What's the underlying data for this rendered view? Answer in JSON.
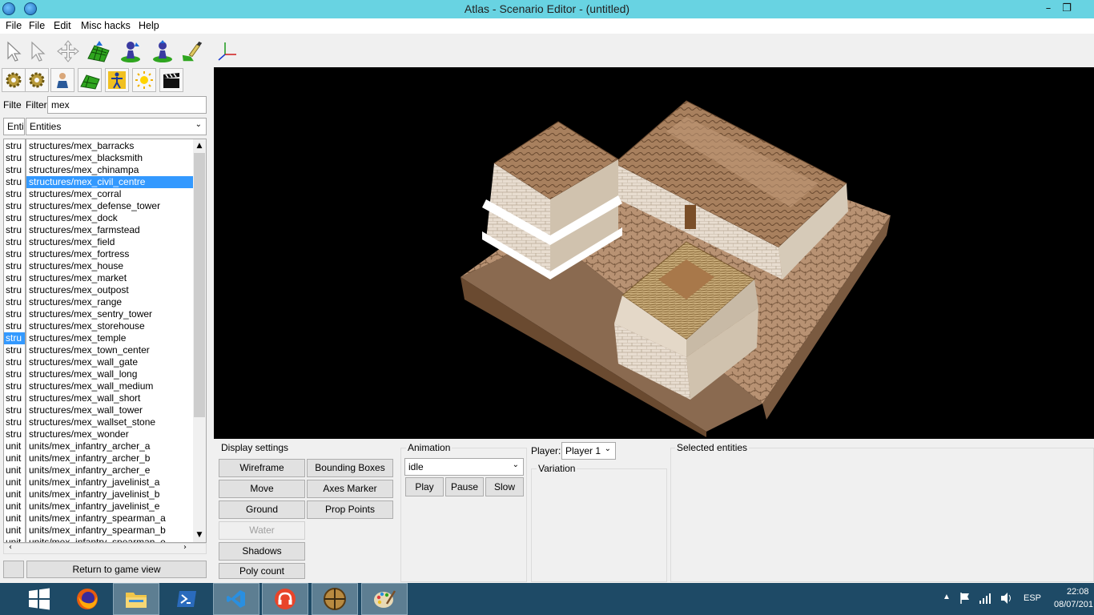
{
  "window": {
    "title": "Atlas - Scenario Editor - (untitled)",
    "minimize_glyph": "–",
    "restore_glyph": "❐",
    "app_icons": [
      "globe-icon",
      "globe-icon"
    ]
  },
  "menu": {
    "items": [
      "File",
      "File",
      "Edit",
      "Misc hacks",
      "Help"
    ]
  },
  "toolbar": {
    "tools": [
      "select-arrow-icon",
      "select-arrow-alt-icon",
      "move-cross-icon",
      "terrain-elevation-icon",
      "player-pawn-icon",
      "player-pawn-alt-icon",
      "paint-brush-icon",
      "axes-icon"
    ],
    "sidebar_tabs": [
      "gear-icon",
      "gear-alt-icon",
      "person-icon",
      "terrain-icon",
      "figure-icon",
      "sun-icon",
      "clapper-icon"
    ]
  },
  "left_panel": {
    "filter_label_short": "Filte",
    "filter_label": "Filter",
    "filter_value": "mex",
    "type_label_short": "Enti",
    "type_select": "Entities",
    "short_column": [
      "stru",
      "stru",
      "stru",
      "stru",
      "stru",
      "stru",
      "stru",
      "stru",
      "stru",
      "stru",
      "stru",
      "stru",
      "stru",
      "stru",
      "stru",
      "stru",
      "stru",
      "stru",
      "stru",
      "stru",
      "stru",
      "stru",
      "stru",
      "stru",
      "stru",
      "unit",
      "unit",
      "unit",
      "unit",
      "unit",
      "unit",
      "unit",
      "unit",
      "unit"
    ],
    "short_selected_index": 16,
    "entities": [
      "structures/mex_barracks",
      "structures/mex_blacksmith",
      "structures/mex_chinampa",
      "structures/mex_civil_centre",
      "structures/mex_corral",
      "structures/mex_defense_tower",
      "structures/mex_dock",
      "structures/mex_farmstead",
      "structures/mex_field",
      "structures/mex_fortress",
      "structures/mex_house",
      "structures/mex_market",
      "structures/mex_outpost",
      "structures/mex_range",
      "structures/mex_sentry_tower",
      "structures/mex_storehouse",
      "structures/mex_temple",
      "structures/mex_town_center",
      "structures/mex_wall_gate",
      "structures/mex_wall_long",
      "structures/mex_wall_medium",
      "structures/mex_wall_short",
      "structures/mex_wall_tower",
      "structures/mex_wallset_stone",
      "structures/mex_wonder",
      "units/mex_infantry_archer_a",
      "units/mex_infantry_archer_b",
      "units/mex_infantry_archer_e",
      "units/mex_infantry_javelinist_a",
      "units/mex_infantry_javelinist_b",
      "units/mex_infantry_javelinist_e",
      "units/mex_infantry_spearman_a",
      "units/mex_infantry_spearman_b",
      "units/mex_infantry_spearman_e"
    ],
    "entity_selected_index": 3,
    "return_button": "Return to game view"
  },
  "display_settings": {
    "title": "Display settings",
    "buttons": {
      "wireframe": "Wireframe",
      "bounding_boxes": "Bounding Boxes",
      "move": "Move",
      "axes_marker": "Axes Marker",
      "ground": "Ground",
      "prop_points": "Prop Points",
      "water": "Water",
      "shadows": "Shadows",
      "poly_count": "Poly count"
    }
  },
  "animation": {
    "title": "Animation",
    "selected": "idle",
    "play": "Play",
    "pause": "Pause",
    "slow": "Slow"
  },
  "player": {
    "label": "Player:",
    "selected": "Player 1",
    "variation_title": "Variation"
  },
  "selected_entities": {
    "title": "Selected entities"
  },
  "taskbar": {
    "apps": [
      "windows-start-icon",
      "firefox-icon",
      "file-explorer-icon",
      "powershell-icon",
      "vscode-icon",
      "headphones-app-icon",
      "zero-ad-icon",
      "paint-icon"
    ],
    "language": "ESP",
    "time": "22:08",
    "date": "08/07/201"
  }
}
